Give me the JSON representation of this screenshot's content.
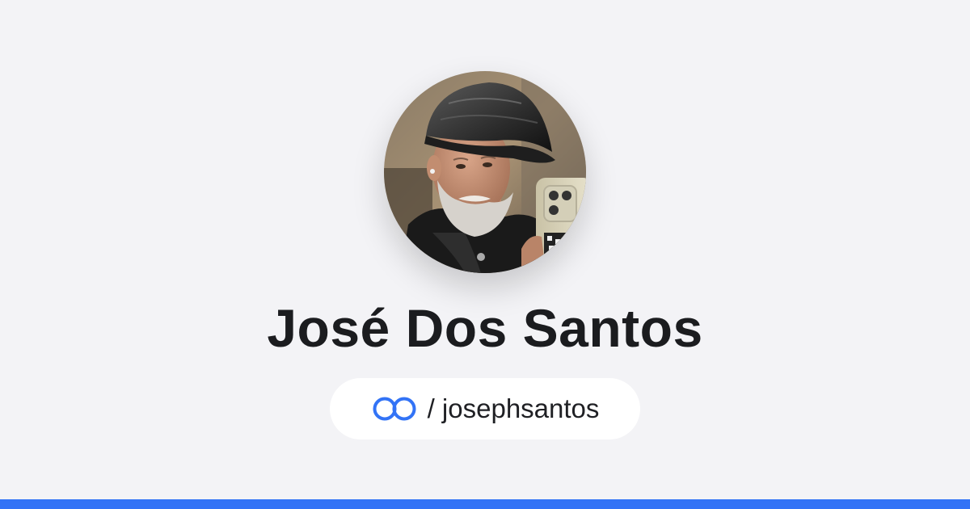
{
  "profile": {
    "name": "José Dos Santos",
    "avatar_alt": "profile photo",
    "handle_separator": "/",
    "username": "josephsantos",
    "handle_display": "/ josephsantos"
  },
  "brand": {
    "logo_icon": "linked-rings-logo-icon",
    "accent_color": "#3273f6",
    "background_color": "#f3f3f6",
    "text_color": "#1b1c1f"
  }
}
